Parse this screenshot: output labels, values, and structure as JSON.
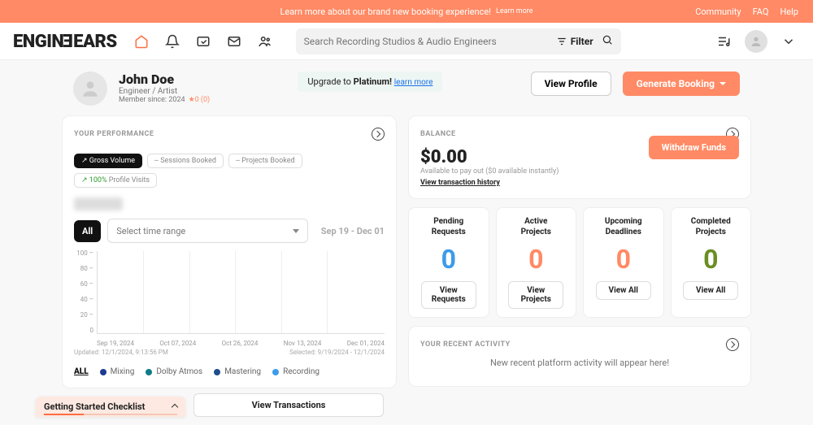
{
  "announce": {
    "text": "Learn more about our brand new booking experience!",
    "cta": "Learn more",
    "links": [
      "Community",
      "FAQ",
      "Help"
    ]
  },
  "brand": {
    "part1": "ENGIN",
    "flip": "E",
    "part2": "EARS"
  },
  "search": {
    "placeholder": "Search Recording Studios & Audio Engineers",
    "filter": "Filter"
  },
  "profile": {
    "name": "John Doe",
    "role": "Engineer / Artist",
    "member": "Member since: 2024",
    "rating": "★0 (0)"
  },
  "upgrade": {
    "pre": "Upgrade to ",
    "bold": "Platinum! ",
    "link": "learn more"
  },
  "buttons": {
    "view_profile": "View Profile",
    "generate": "Generate Booking"
  },
  "perf": {
    "title": "YOUR PERFORMANCE",
    "pills": [
      {
        "pre": "↗ ",
        "label": "Gross Volume",
        "active": true
      },
      {
        "pre": "-- ",
        "label": "Sessions Booked"
      },
      {
        "pre": "-- ",
        "label": "Projects Booked"
      },
      {
        "pre": "↗ 100% ",
        "label": "Profile Visits",
        "green": true
      }
    ],
    "all": "All",
    "select": "Select time range",
    "range": "Sep 19  -  Dec 01"
  },
  "chart_data": {
    "type": "line",
    "title": "",
    "ylim": [
      0,
      100
    ],
    "yticks": [
      100,
      80,
      60,
      40,
      20,
      0
    ],
    "categories": [
      "Sep 19, 2024",
      "Oct 07, 2024",
      "Oct 26, 2024",
      "Nov 13, 2024",
      "Dec 01, 2024"
    ],
    "series": [
      {
        "name": "Mixing",
        "color": "#1f3a93",
        "values": [
          0,
          0,
          0,
          0,
          0
        ]
      },
      {
        "name": "Dolby Atmos",
        "color": "#0e7c86",
        "values": [
          0,
          0,
          0,
          0,
          0
        ]
      },
      {
        "name": "Mastering",
        "color": "#1e4e8c",
        "values": [
          0,
          0,
          0,
          0,
          0
        ]
      },
      {
        "name": "Recording",
        "color": "#3d9be9",
        "values": [
          0,
          0,
          0,
          0,
          0
        ]
      }
    ],
    "legend_all": "ALL",
    "updated": "Updated: 12/1/2024, 9:13:56 PM",
    "selected": "Selected: 9/19/2024 - 12/1/2024"
  },
  "balance": {
    "title": "BALANCE",
    "amount": "$0.00",
    "sub": "Available to pay out ($0 available instantly)",
    "link": "View transaction history",
    "withdraw": "Withdraw Funds"
  },
  "stats": [
    {
      "l1": "Pending",
      "l2": "Requests",
      "num": "0",
      "color": "#3d9be9",
      "btn": "View Requests"
    },
    {
      "l1": "Active",
      "l2": "Projects",
      "num": "0",
      "color": "#ff8a65",
      "btn": "View Projects"
    },
    {
      "l1": "Upcoming",
      "l2": "Deadlines",
      "num": "0",
      "color": "#ff8a65",
      "btn": "View All"
    },
    {
      "l1": "Completed",
      "l2": "Projects",
      "num": "0",
      "color": "#6b8e23",
      "btn": "View All"
    }
  ],
  "recent": {
    "title": "YOUR RECENT ACTIVITY",
    "empty": "New recent platform activity will appear here!"
  },
  "gs": "Getting Started Checklist",
  "vt": "View Transactions"
}
